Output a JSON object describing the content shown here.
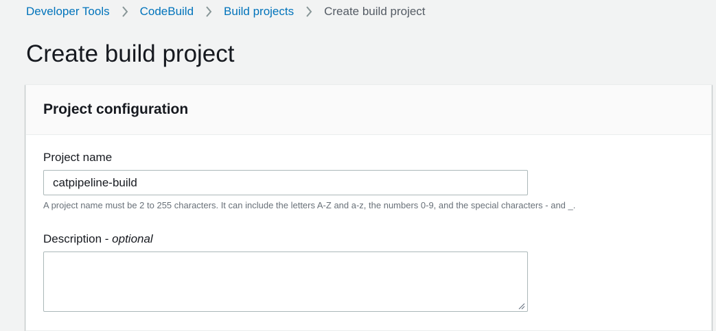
{
  "breadcrumb": {
    "items": [
      {
        "label": "Developer Tools"
      },
      {
        "label": "CodeBuild"
      },
      {
        "label": "Build projects"
      },
      {
        "label": "Create build project"
      }
    ],
    "separator_icon": "chevron-right-icon"
  },
  "page": {
    "title": "Create build project"
  },
  "project_configuration": {
    "heading": "Project configuration",
    "project_name": {
      "label": "Project name",
      "value": "catpipeline-build",
      "constraint": "A project name must be 2 to 255 characters. It can include the letters A-Z and a-z, the numbers 0-9, and the special characters - and _."
    },
    "description": {
      "label": "Description",
      "label_separator": " - ",
      "optional_tag": "optional",
      "value": ""
    }
  },
  "colors": {
    "link": "#0073bb",
    "text": "#16191f",
    "muted": "#687078",
    "background": "#f2f3f3",
    "border": "#aab7b8"
  }
}
